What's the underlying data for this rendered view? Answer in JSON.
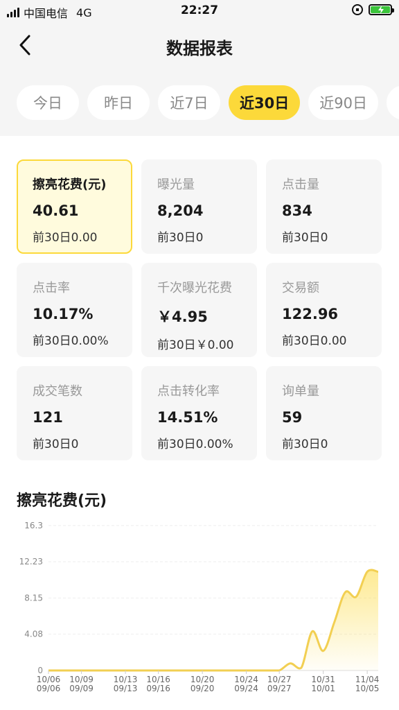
{
  "status_bar": {
    "carrier": "中国电信",
    "network": "4G",
    "time": "22:27"
  },
  "nav": {
    "title": "数据报表",
    "back_icon": "chevron-left-icon"
  },
  "tabs": [
    {
      "label": "今日",
      "active": false
    },
    {
      "label": "昨日",
      "active": false
    },
    {
      "label": "近7日",
      "active": false
    },
    {
      "label": "近30日",
      "active": true
    },
    {
      "label": "近90日",
      "active": false
    }
  ],
  "metrics": [
    {
      "label": "擦亮花费(元)",
      "value": "40.61",
      "prev": "前30日0.00",
      "active": true
    },
    {
      "label": "曝光量",
      "value": "8,204",
      "prev": "前30日0",
      "active": false
    },
    {
      "label": "点击量",
      "value": "834",
      "prev": "前30日0",
      "active": false
    },
    {
      "label": "点击率",
      "value": "10.17%",
      "prev": "前30日0.00%",
      "active": false
    },
    {
      "label": "千次曝光花费",
      "value": "￥4.95",
      "prev": "前30日￥0.00",
      "active": false
    },
    {
      "label": "交易额",
      "value": "122.96",
      "prev": "前30日0.00",
      "active": false
    },
    {
      "label": "成交笔数",
      "value": "121",
      "prev": "前30日0",
      "active": false
    },
    {
      "label": "点击转化率",
      "value": "14.51%",
      "prev": "前30日0.00%",
      "active": false
    },
    {
      "label": "询单量",
      "value": "59",
      "prev": "前30日0",
      "active": false
    }
  ],
  "chart_title": "擦亮花费(元)",
  "colors": {
    "accent": "#fcd93a",
    "line": "#f2cf52",
    "active_card_bg": "#fffbdd"
  },
  "chart_data": {
    "type": "area",
    "title": "",
    "xlabel": "",
    "ylabel": "",
    "ylim": [
      0,
      16.3
    ],
    "yticks": [
      "0",
      "4.08",
      "8.15",
      "12.23",
      "16.3"
    ],
    "ytick_values": [
      0,
      4.08,
      8.15,
      12.23,
      16.3
    ],
    "xtick_labels": [
      {
        "top": "10/06",
        "bottom": "09/06",
        "index": 0
      },
      {
        "top": "10/09",
        "bottom": "09/09",
        "index": 3
      },
      {
        "top": "10/13",
        "bottom": "09/13",
        "index": 7
      },
      {
        "top": "10/16",
        "bottom": "09/16",
        "index": 10
      },
      {
        "top": "10/20",
        "bottom": "09/20",
        "index": 14
      },
      {
        "top": "10/24",
        "bottom": "09/24",
        "index": 18
      },
      {
        "top": "10/27",
        "bottom": "09/27",
        "index": 21
      },
      {
        "top": "10/31",
        "bottom": "10/01",
        "index": 25
      },
      {
        "top": "11/04",
        "bottom": "10/05",
        "index": 29
      }
    ],
    "x": [
      "10/06",
      "10/07",
      "10/08",
      "10/09",
      "10/10",
      "10/11",
      "10/12",
      "10/13",
      "10/14",
      "10/15",
      "10/16",
      "10/17",
      "10/18",
      "10/19",
      "10/20",
      "10/21",
      "10/22",
      "10/23",
      "10/24",
      "10/25",
      "10/26",
      "10/27",
      "10/28",
      "10/29",
      "10/30",
      "10/31",
      "11/01",
      "11/02",
      "11/03",
      "11/04",
      "11/05"
    ],
    "series": [
      {
        "values": [
          0,
          0,
          0,
          0,
          0,
          0,
          0,
          0,
          0,
          0,
          0,
          0,
          0,
          0,
          0,
          0,
          0,
          0,
          0,
          0,
          0,
          0,
          0.8,
          0.3,
          4.4,
          2.2,
          5.4,
          8.8,
          8.3,
          11.1,
          11.1
        ]
      }
    ],
    "grid": true
  }
}
